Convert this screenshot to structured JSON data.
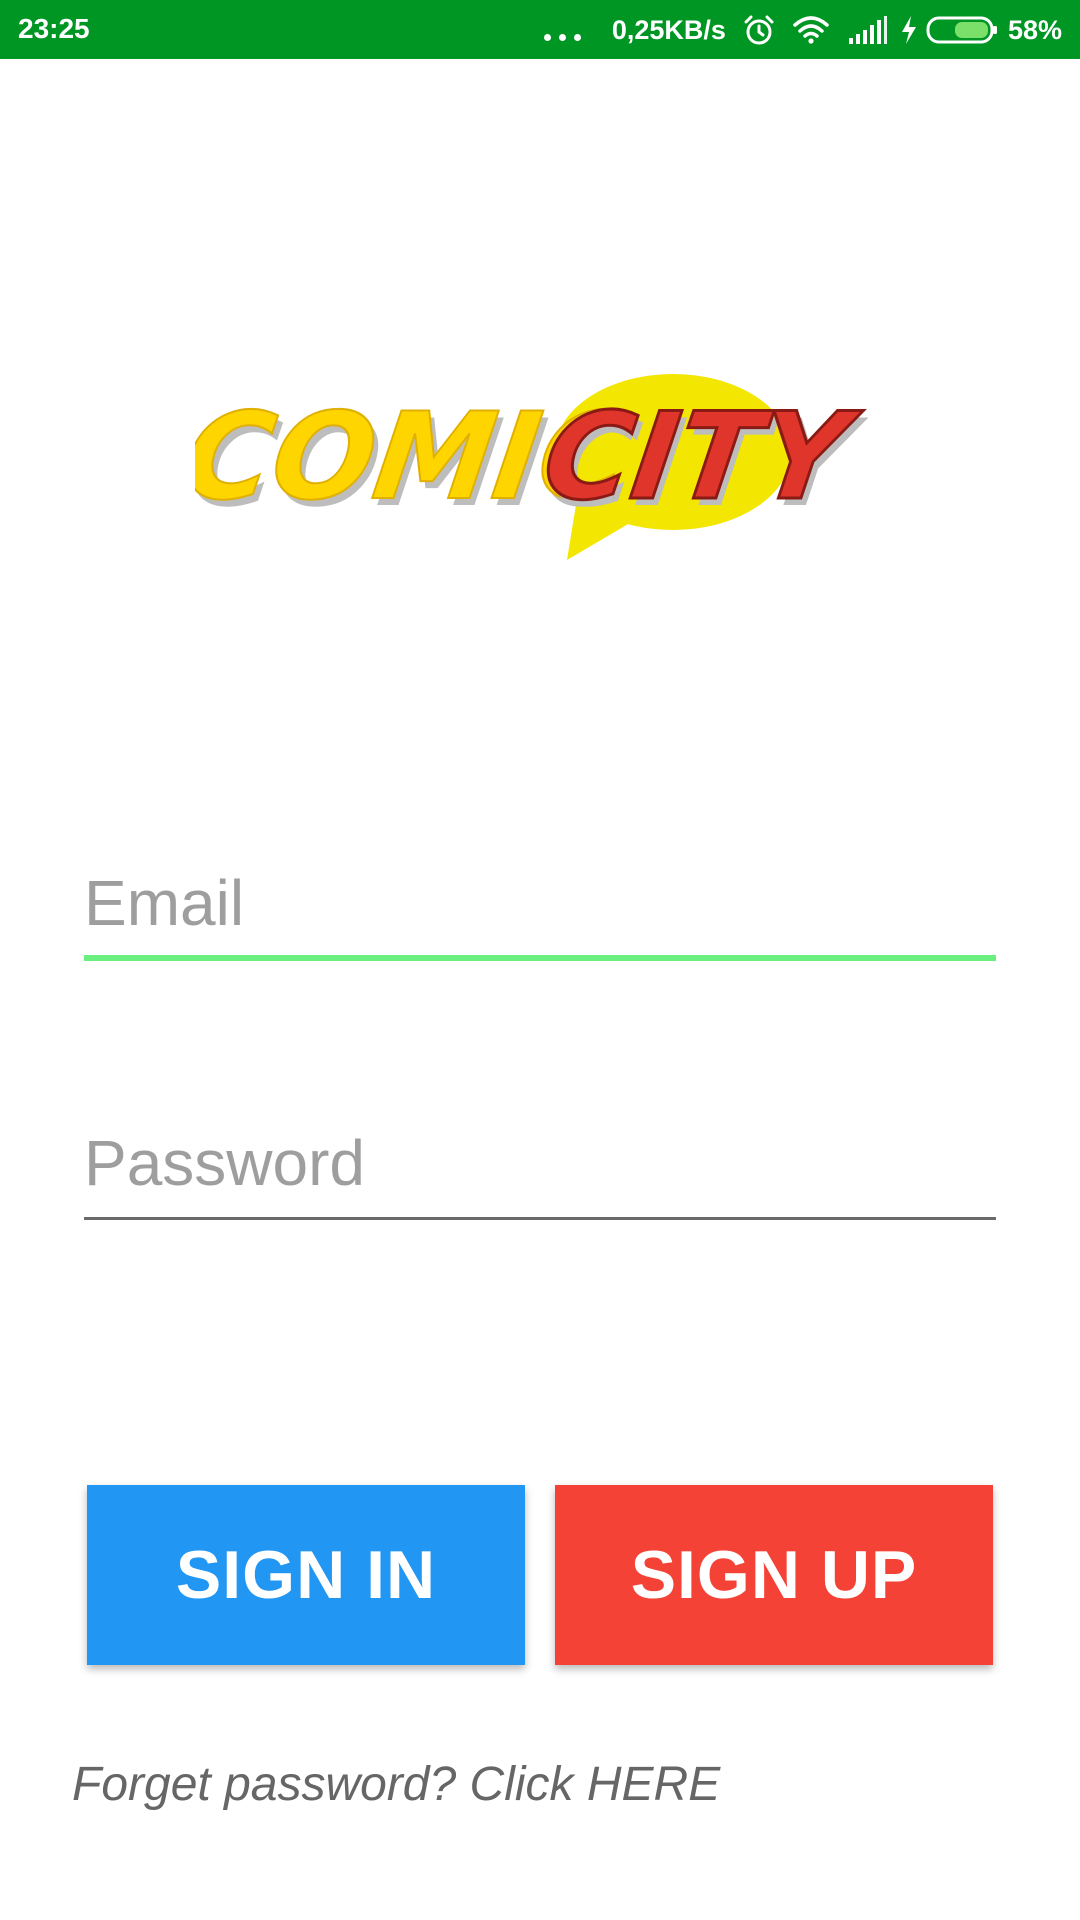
{
  "status_bar": {
    "time": "23:25",
    "network_speed": "0,25KB/s",
    "battery_percent": "58%",
    "icons": [
      "more-dots-icon",
      "alarm-icon",
      "wifi-icon",
      "signal-icon",
      "charging-icon",
      "battery-icon"
    ],
    "background_color": "#009624"
  },
  "logo": {
    "text_left": "COMIC",
    "text_right": "CITY",
    "colors": {
      "comic_fill": "#ffd500",
      "city_fill": "#e0352b",
      "bubble": "#f3e600",
      "shadow": "#bdbdbd"
    }
  },
  "form": {
    "email": {
      "placeholder": "Email",
      "value": "",
      "underline_color": "#69f07f"
    },
    "password": {
      "placeholder": "Password",
      "value": "",
      "underline_color": "#6a6a6a"
    }
  },
  "buttons": {
    "sign_in": {
      "label": "SIGN IN",
      "color": "#2196f3"
    },
    "sign_up": {
      "label": "SIGN UP",
      "color": "#f44336"
    }
  },
  "forgot_password": {
    "text": "Forget password? Click HERE"
  }
}
